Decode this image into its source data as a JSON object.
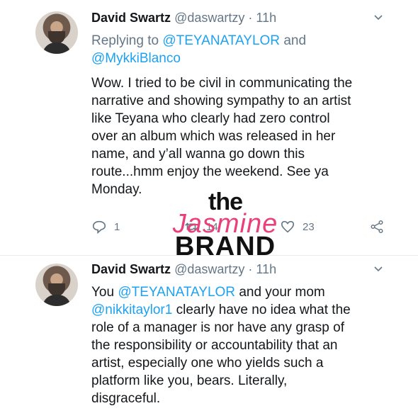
{
  "tweets": [
    {
      "name": "David Swartz",
      "handle": "@daswartzy",
      "separator": "·",
      "time": "11h",
      "replying_prefix": "Replying to",
      "reply_mention_1": "@TEYANATAYLOR",
      "reply_and": "and",
      "reply_mention_2": "@MykkiBlanco",
      "text_lines": [
        "Wow. I tried to be civil in communicating the",
        "narrative and showing sympathy to an artist",
        "like Teyana who clearly had zero control",
        "over an album which was released in her",
        "name, and y’all wanna go down this",
        "route...hmm enjoy the weekend. See ya",
        "Monday."
      ],
      "reply_count": "1",
      "retweet_count": "14",
      "like_count": "23"
    },
    {
      "name": "David Swartz",
      "handle": "@daswartzy",
      "separator": "·",
      "time": "11h",
      "line1_prefix": "You",
      "line1_mention": "@TEYANATAYLOR",
      "line1_suffix": "and your mom",
      "line2_mention": "@nikkitaylor1",
      "line2_suffix": "clearly have no idea what the",
      "text_lines": [
        "role of a manager is nor have any grasp of",
        "the responsibility or accountability that an",
        "artist, especially one who yields such a",
        "platform like you, bears. Literally,",
        "disgraceful."
      ]
    }
  ],
  "watermark": {
    "line1": "the",
    "line2": "Jasmine",
    "line3": "BRAND"
  },
  "icons": {
    "reply": "reply-icon",
    "retweet": "retweet-icon",
    "like": "heart-icon",
    "share": "share-icon",
    "more": "chevron-down-icon"
  },
  "colors": {
    "link": "#1da1f2",
    "muted": "#657786",
    "text": "#14171a",
    "watermark_pink": "#e8417a"
  }
}
